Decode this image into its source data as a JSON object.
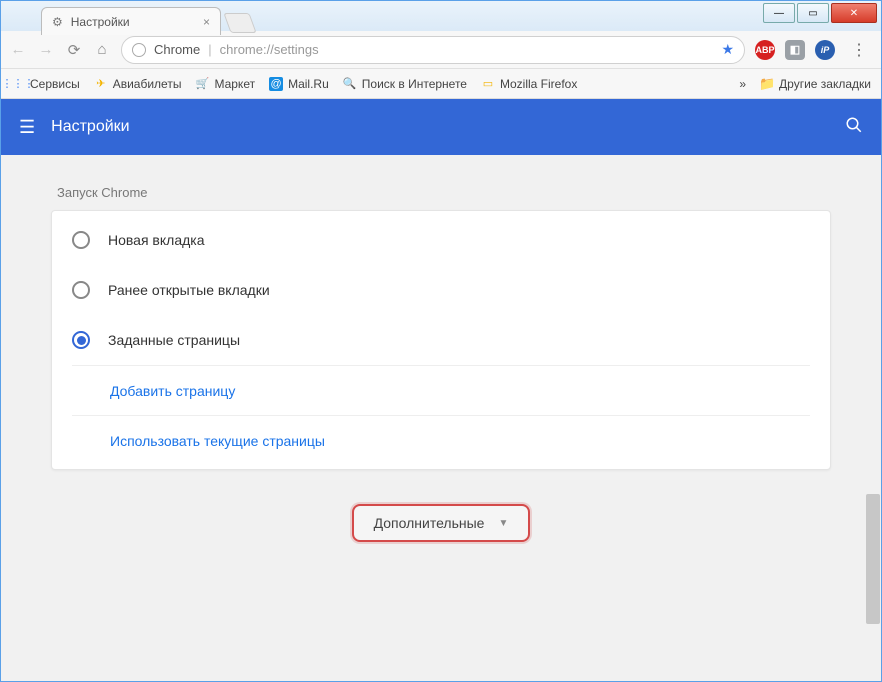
{
  "window": {
    "tab_title": "Настройки"
  },
  "omnibox": {
    "prefix": "Chrome",
    "path": "chrome://settings"
  },
  "bookmarks": {
    "items": [
      {
        "label": "Сервисы"
      },
      {
        "label": "Авиабилеты"
      },
      {
        "label": "Маркет"
      },
      {
        "label": "Mail.Ru"
      },
      {
        "label": "Поиск в Интернете"
      },
      {
        "label": "Mozilla Firefox"
      }
    ],
    "overflow": "»",
    "other": "Другие закладки"
  },
  "header": {
    "title": "Настройки"
  },
  "startup": {
    "section_label": "Запуск Chrome",
    "options": [
      {
        "label": "Новая вкладка",
        "selected": false
      },
      {
        "label": "Ранее открытые вкладки",
        "selected": false
      },
      {
        "label": "Заданные страницы",
        "selected": true
      }
    ],
    "add_page": "Добавить страницу",
    "use_current": "Использовать текущие страницы"
  },
  "advanced": {
    "label": "Дополнительные"
  }
}
